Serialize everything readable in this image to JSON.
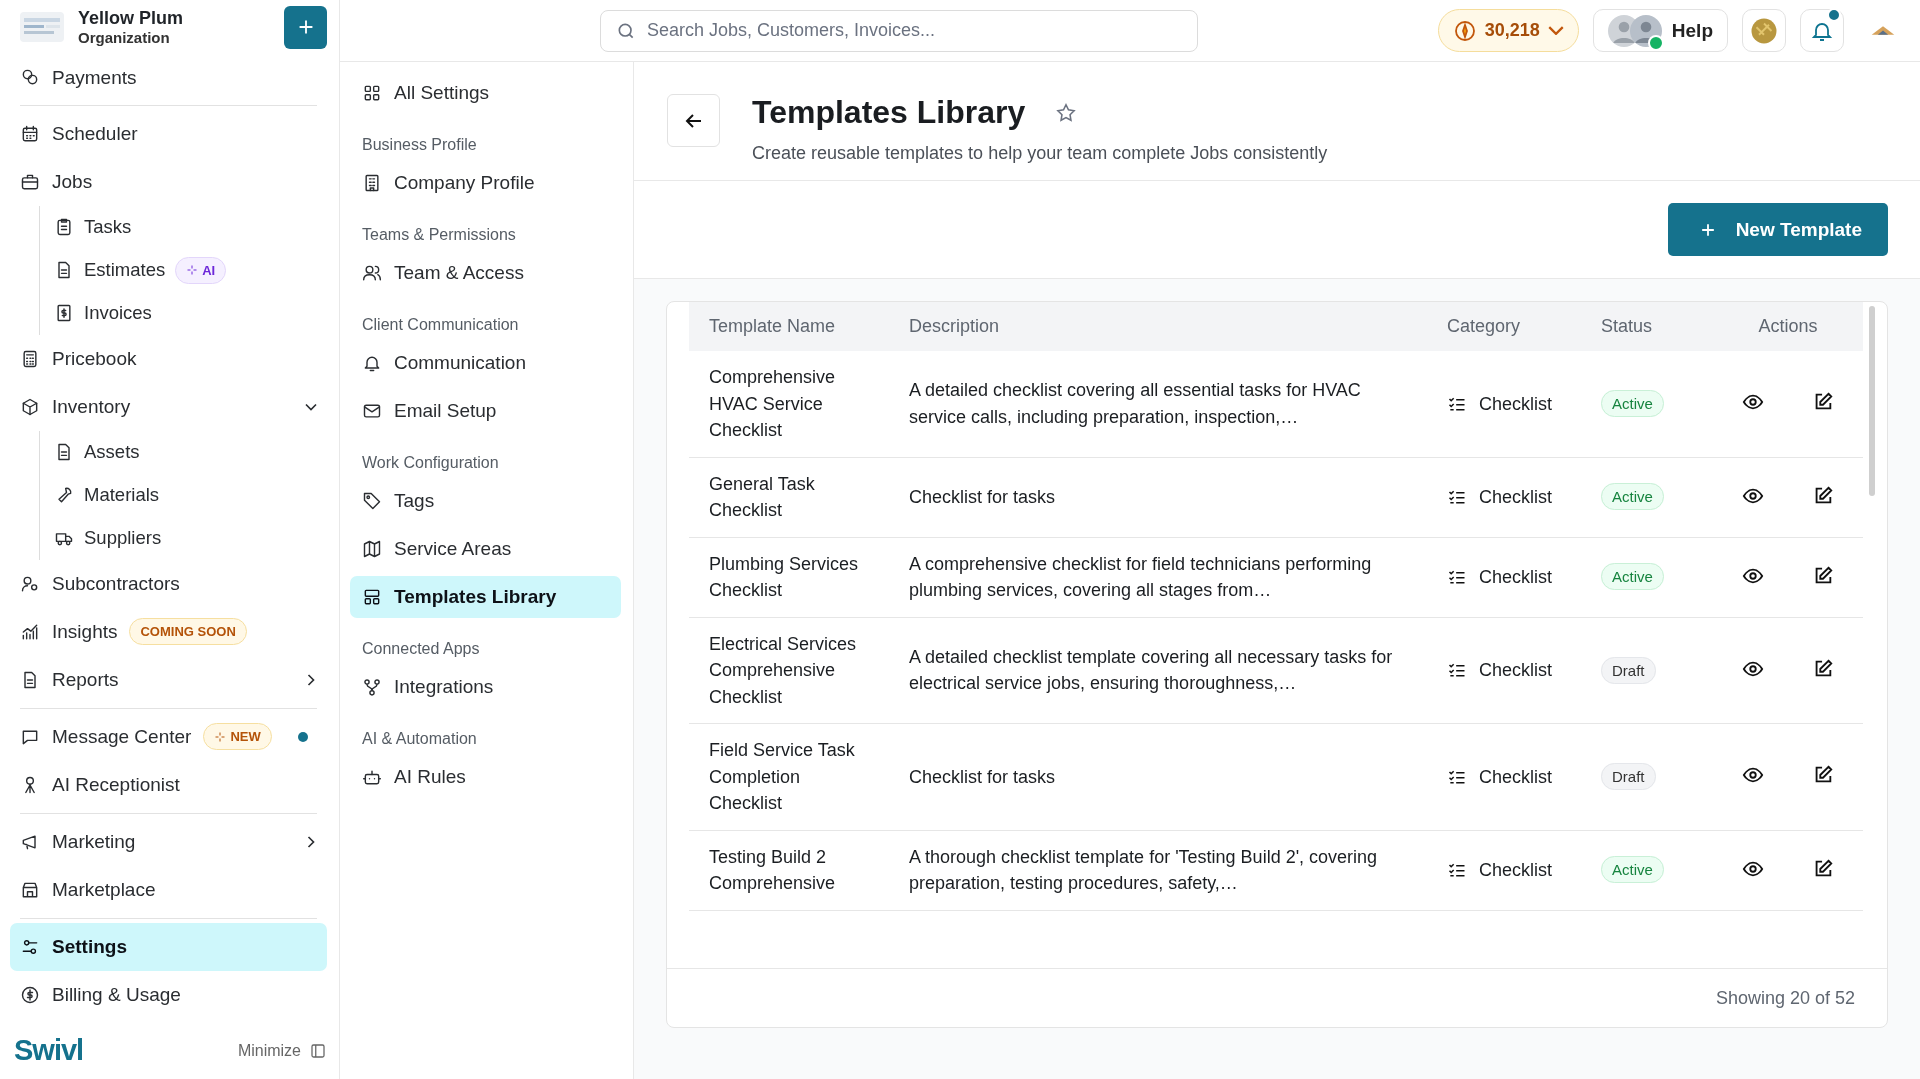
{
  "org": {
    "name": "Yellow Plum",
    "subtitle": "Organization"
  },
  "sidebar": {
    "groups": [
      [
        {
          "label": "Payments",
          "selected": false
        }
      ],
      [
        {
          "label": "Scheduler",
          "selected": false
        },
        {
          "label": "Jobs",
          "selected": false,
          "children": [
            {
              "label": "Tasks",
              "selected": false
            },
            {
              "label": "Estimates",
              "selected": false,
              "badge": {
                "kind": "ai",
                "text": "AI"
              }
            },
            {
              "label": "Invoices",
              "selected": false
            }
          ]
        },
        {
          "label": "Pricebook",
          "selected": false
        },
        {
          "label": "Inventory",
          "selected": false,
          "expanded": true,
          "children": [
            {
              "label": "Assets",
              "selected": false
            },
            {
              "label": "Materials",
              "selected": false
            },
            {
              "label": "Suppliers",
              "selected": false
            }
          ]
        },
        {
          "label": "Subcontractors",
          "selected": false
        },
        {
          "label": "Insights",
          "selected": false,
          "badge": {
            "kind": "soon",
            "text": "COMING SOON"
          }
        },
        {
          "label": "Reports",
          "selected": false,
          "expanded": false
        }
      ],
      [
        {
          "label": "Message Center",
          "selected": false,
          "badge": {
            "kind": "new",
            "text": "NEW"
          },
          "unread": true
        },
        {
          "label": "AI Receptionist",
          "selected": false
        }
      ],
      [
        {
          "label": "Marketing",
          "selected": false,
          "expanded": false
        },
        {
          "label": "Marketplace",
          "selected": false
        }
      ],
      [
        {
          "label": "Settings",
          "selected": true
        },
        {
          "label": "Billing & Usage",
          "selected": false
        }
      ]
    ],
    "brand": "Swivl",
    "minimize": "Minimize"
  },
  "header": {
    "search_placeholder": "Search Jobs, Customers, Invoices...",
    "credits": "30,218",
    "help": "Help",
    "notifications_unread": true
  },
  "settings_nav": {
    "all": "All Settings",
    "sections": [
      {
        "title": "Business Profile",
        "items": [
          {
            "label": "Company Profile",
            "selected": false
          }
        ]
      },
      {
        "title": "Teams & Permissions",
        "items": [
          {
            "label": "Team & Access",
            "selected": false
          }
        ]
      },
      {
        "title": "Client Communication",
        "items": [
          {
            "label": "Communication",
            "selected": false
          },
          {
            "label": "Email Setup",
            "selected": false
          }
        ]
      },
      {
        "title": "Work Configuration",
        "items": [
          {
            "label": "Tags",
            "selected": false
          },
          {
            "label": "Service Areas",
            "selected": false
          },
          {
            "label": "Templates Library",
            "selected": true
          }
        ]
      },
      {
        "title": "Connected Apps",
        "items": [
          {
            "label": "Integrations",
            "selected": false
          }
        ]
      },
      {
        "title": "AI & Automation",
        "items": [
          {
            "label": "AI Rules",
            "selected": false
          }
        ]
      }
    ]
  },
  "page": {
    "title": "Templates Library",
    "favorite": false,
    "subtitle": "Create reusable templates to help your team complete Jobs consistently",
    "new_button": "New Template"
  },
  "table": {
    "columns": [
      "Template Name",
      "Description",
      "Category",
      "Status",
      "Actions"
    ],
    "rows": [
      {
        "name": "Comprehensive HVAC Service Checklist",
        "description": "A detailed checklist covering all essential tasks for HVAC service calls, including preparation, inspection,…",
        "category": "Checklist",
        "status": {
          "label": "Active",
          "active": true
        }
      },
      {
        "name": "General Task Checklist",
        "description": "Checklist for tasks",
        "category": "Checklist",
        "status": {
          "label": "Active",
          "active": true
        }
      },
      {
        "name": "Plumbing Services Checklist",
        "description": "A comprehensive checklist for field technicians performing plumbing services, covering all stages from…",
        "category": "Checklist",
        "status": {
          "label": "Active",
          "active": true
        }
      },
      {
        "name": "Electrical Services Comprehensive Checklist",
        "description": "A detailed checklist template covering all necessary tasks for electrical service jobs, ensuring thoroughness,…",
        "category": "Checklist",
        "status": {
          "label": "Draft",
          "active": false
        }
      },
      {
        "name": "Field Service Task Completion Checklist",
        "description": "Checklist for tasks",
        "category": "Checklist",
        "status": {
          "label": "Draft",
          "active": false
        }
      },
      {
        "name": "Testing Build 2 Comprehensive",
        "description": "A thorough checklist template for 'Testing Build 2', covering preparation, testing procedures, safety,…",
        "category": "Checklist",
        "status": {
          "label": "Active",
          "active": true
        }
      }
    ],
    "footer": "Showing 20 of 52"
  }
}
